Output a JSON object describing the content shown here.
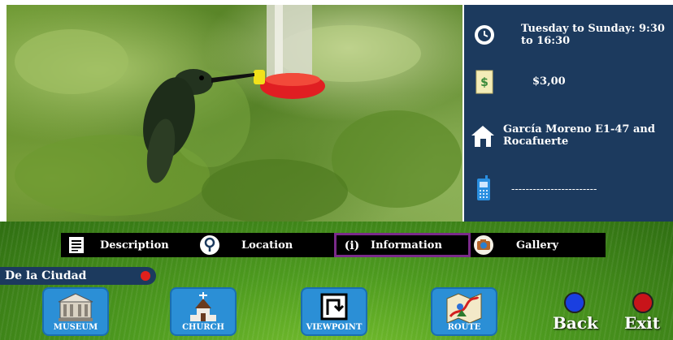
{
  "info": {
    "schedule": {
      "icon": "clock-icon",
      "text": "Tuesday to Sunday: 9:30 to 16:30"
    },
    "price": {
      "icon": "money-icon",
      "text": "$3,00"
    },
    "address": {
      "icon": "house-icon",
      "text": "García Moreno E1-47 and Rocafuerte"
    },
    "phone": {
      "icon": "phone-icon",
      "text": "------------------------"
    }
  },
  "tabs": [
    {
      "label": "Description",
      "icon": "document-icon"
    },
    {
      "label": "Location",
      "icon": "map-pin-icon"
    },
    {
      "label": "Information",
      "icon": "info-icon",
      "active": true
    },
    {
      "label": "Gallery",
      "icon": "camera-icon"
    }
  ],
  "place_name": "De la Ciudad",
  "nav": [
    {
      "label": "MUSEUM",
      "icon": "museum-icon"
    },
    {
      "label": "CHURCH",
      "icon": "church-icon"
    },
    {
      "label": "VIEWPOINT",
      "icon": "viewpoint-icon"
    },
    {
      "label": "ROUTE",
      "icon": "route-map-icon"
    }
  ],
  "controls": {
    "back": {
      "label": "Back",
      "color": "#1a3fe0"
    },
    "exit": {
      "label": "Exit",
      "color": "#c8141a"
    }
  },
  "colors": {
    "panel": "#1c3a5e",
    "active_tab_border": "#7a2a8a",
    "nav_button": "#2b8fd6"
  }
}
